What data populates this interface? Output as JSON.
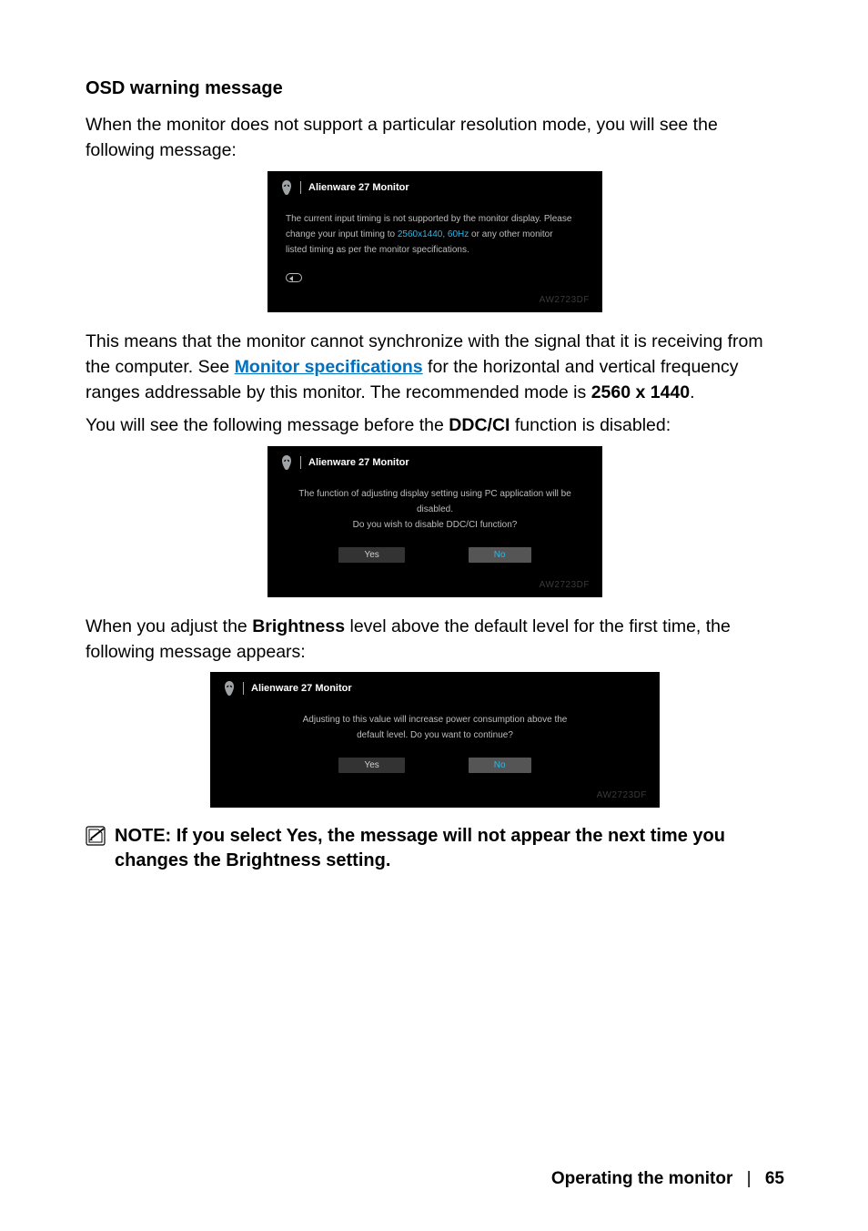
{
  "heading": "OSD warning message",
  "p1": "When the monitor does not support a particular resolution mode, you will see the following message:",
  "osd1": {
    "title": "Alienware 27 Monitor",
    "line1": "The current input timing is not supported by the monitor display. Please",
    "line2_pre": "change your input timing to ",
    "line2_highlight": "2560x1440, 60Hz",
    "line2_post": " or any other monitor",
    "line3": "listed timing as per the monitor specifications.",
    "model": "AW2723DF"
  },
  "p2_pre": "This means that the monitor cannot synchronize with the signal that it is receiving from the computer. See ",
  "p2_link": "Monitor specifications",
  "p2_mid": " for the horizontal and vertical frequency ranges addressable by this monitor. The recommended mode is ",
  "p2_bold": "2560 x 1440",
  "p2_post": ".",
  "p3_pre": "You will see the following message before the ",
  "p3_bold": "DDC/CI",
  "p3_post": " function is disabled:",
  "osd2": {
    "title": "Alienware 27 Monitor",
    "line1": "The function of adjusting display setting using PC application will be",
    "line2": "disabled.",
    "line3": "Do you wish to disable DDC/CI function?",
    "btn_yes": "Yes",
    "btn_no": "No",
    "model": "AW2723DF"
  },
  "p4_pre": "When you adjust the ",
  "p4_bold": "Brightness",
  "p4_post": " level above the default level for the first time, the following message appears:",
  "osd3": {
    "title": "Alienware 27 Monitor",
    "line1": "Adjusting to this value will increase power consumption above the",
    "line2": "default level. Do you want to continue?",
    "btn_yes": "Yes",
    "btn_no": "No",
    "model": "AW2723DF"
  },
  "note": "NOTE: If you select Yes, the message will not appear the next time you changes the Brightness setting.",
  "footer": {
    "title": "Operating the monitor",
    "page": "65",
    "sep": "|"
  }
}
